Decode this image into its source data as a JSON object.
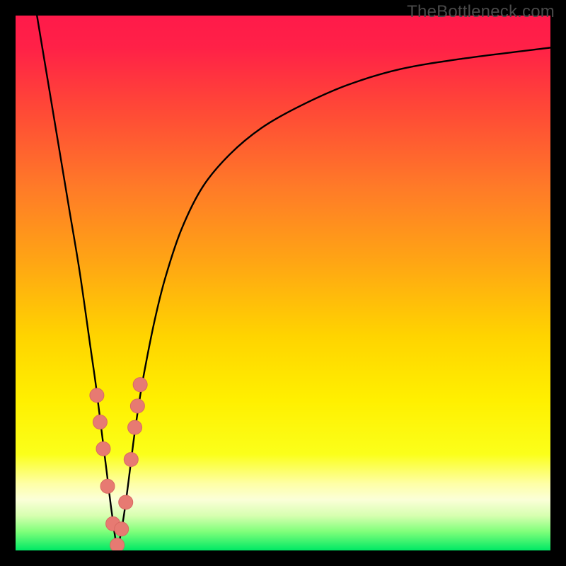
{
  "watermark": "TheBottleneck.com",
  "colors": {
    "frame": "#000000",
    "curve": "#000000",
    "dot_fill": "#e77a72",
    "dot_stroke": "#d86a62",
    "gradient_stops": [
      {
        "offset": 0.0,
        "color": "#ff1a4a"
      },
      {
        "offset": 0.06,
        "color": "#ff2147"
      },
      {
        "offset": 0.18,
        "color": "#ff4a36"
      },
      {
        "offset": 0.32,
        "color": "#ff7a28"
      },
      {
        "offset": 0.46,
        "color": "#ffa514"
      },
      {
        "offset": 0.6,
        "color": "#ffd400"
      },
      {
        "offset": 0.72,
        "color": "#fff000"
      },
      {
        "offset": 0.82,
        "color": "#fbff1a"
      },
      {
        "offset": 0.875,
        "color": "#feffa6"
      },
      {
        "offset": 0.905,
        "color": "#fbffd8"
      },
      {
        "offset": 0.935,
        "color": "#d7ffb0"
      },
      {
        "offset": 0.965,
        "color": "#7fff7a"
      },
      {
        "offset": 1.0,
        "color": "#00e865"
      }
    ]
  },
  "chart_data": {
    "type": "line",
    "title": "",
    "xlabel": "",
    "ylabel": "",
    "xlim": [
      0,
      100
    ],
    "ylim": [
      0,
      100
    ],
    "note": "V-shaped bottleneck curve. y≈100 is top (red, high bottleneck), y≈0 is bottom (green, no bottleneck). Minimum near x≈19.",
    "series": [
      {
        "name": "bottleneck-curve",
        "x": [
          4,
          6,
          8,
          10,
          12,
          14,
          15,
          16,
          17,
          18,
          19,
          20,
          21,
          22,
          23,
          24,
          26,
          28,
          31,
          35,
          40,
          46,
          53,
          62,
          72,
          84,
          100
        ],
        "y": [
          100,
          88,
          76,
          64,
          52,
          38,
          31,
          23,
          15,
          7,
          1,
          5,
          12,
          20,
          27,
          33,
          43,
          51,
          60,
          68,
          74,
          79,
          83,
          87,
          90,
          92,
          94
        ]
      }
    ],
    "points": {
      "name": "highlight-dots",
      "x": [
        15.2,
        15.8,
        16.4,
        17.2,
        18.2,
        19.0,
        19.8,
        20.6,
        21.6,
        22.3,
        22.8,
        23.3
      ],
      "y": [
        29,
        24,
        19,
        12,
        5,
        1,
        4,
        9,
        17,
        23,
        27,
        31
      ]
    }
  }
}
